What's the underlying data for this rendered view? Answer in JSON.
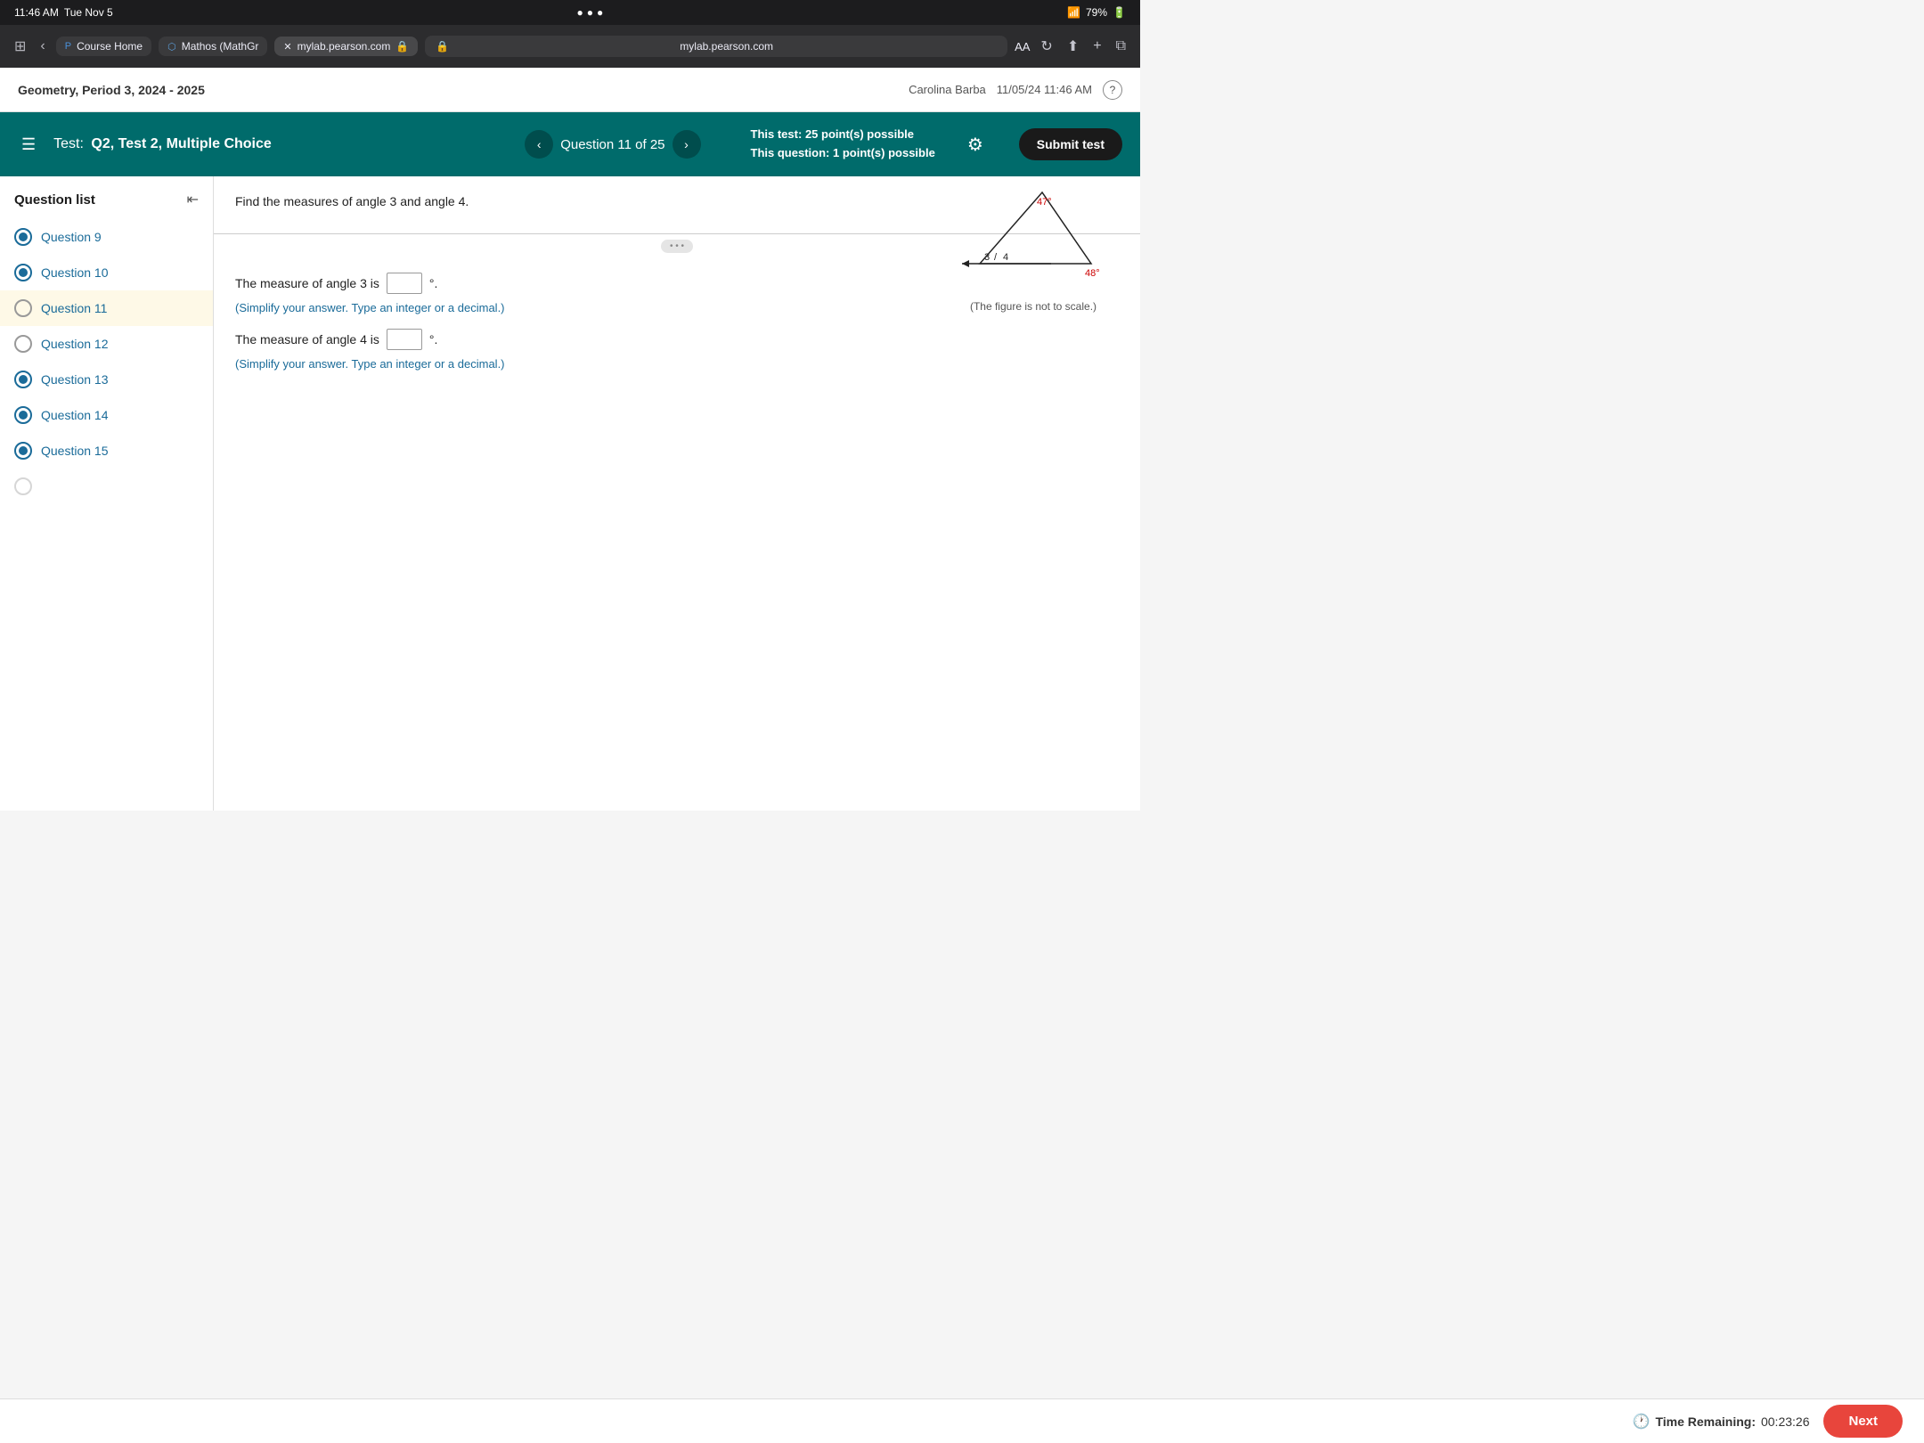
{
  "statusBar": {
    "time": "11:46 AM",
    "day": "Tue Nov 5",
    "wifi": "WiFi",
    "battery": "79%"
  },
  "browser": {
    "tabs": [
      {
        "id": "sidebar",
        "label": "sidebar-icon",
        "active": false
      },
      {
        "id": "course",
        "label": "Course Home",
        "icon": "P",
        "active": false
      },
      {
        "id": "mathos",
        "label": "Mathos (MathGr",
        "icon": "M",
        "active": false
      },
      {
        "id": "pearson",
        "label": "mylab.pearson.com",
        "icon": "🔒",
        "active": true
      }
    ],
    "url": "mylab.pearson.com",
    "urlIcon": "🔒"
  },
  "pageHeader": {
    "courseInfo": "Geometry, Period 3, 2024 - 2025",
    "user": "Carolina Barba",
    "dateTime": "11/05/24 11:46 AM",
    "helpIcon": "?"
  },
  "testHeader": {
    "testLabel": "Test:",
    "testTitle": "Q2, Test 2, Multiple Choice",
    "questionLabel": "Question 11 of 25",
    "thisTestLabel": "This test:",
    "thisTestValue": "25 point(s) possible",
    "thisQuestionLabel": "This question:",
    "thisQuestionValue": "1 point(s) possible",
    "submitButton": "Submit test"
  },
  "sidebar": {
    "title": "Question list",
    "questions": [
      {
        "id": 9,
        "label": "Question 9",
        "status": "filled",
        "active": false
      },
      {
        "id": 10,
        "label": "Question 10",
        "status": "filled",
        "active": false
      },
      {
        "id": 11,
        "label": "Question 11",
        "status": "empty",
        "active": true
      },
      {
        "id": 12,
        "label": "Question 12",
        "status": "empty",
        "active": false
      },
      {
        "id": 13,
        "label": "Question 13",
        "status": "filled",
        "active": false
      },
      {
        "id": 14,
        "label": "Question 14",
        "status": "filled",
        "active": false
      },
      {
        "id": 15,
        "label": "Question 15",
        "status": "filled",
        "active": false
      }
    ]
  },
  "question": {
    "instruction": "Find the measures of angle 3 and angle 4.",
    "figureCaption": "(The figure is not to scale.)",
    "angle47Label": "47°",
    "angle48Label": "48°",
    "angle3Label": "3",
    "angle4Label": "4",
    "angle3Prompt": "The measure of angle 3 is",
    "angle3Suffix": "°.",
    "angle3Hint": "(Simplify your answer. Type an integer or a decimal.)",
    "angle4Prompt": "The measure of angle 4 is",
    "angle4Suffix": "°.",
    "angle4Hint": "(Simplify your answer. Type an integer or a decimal.)"
  },
  "bottomBar": {
    "timeLabel": "Time Remaining:",
    "timeValue": "00:23:26",
    "nextButton": "Next"
  }
}
